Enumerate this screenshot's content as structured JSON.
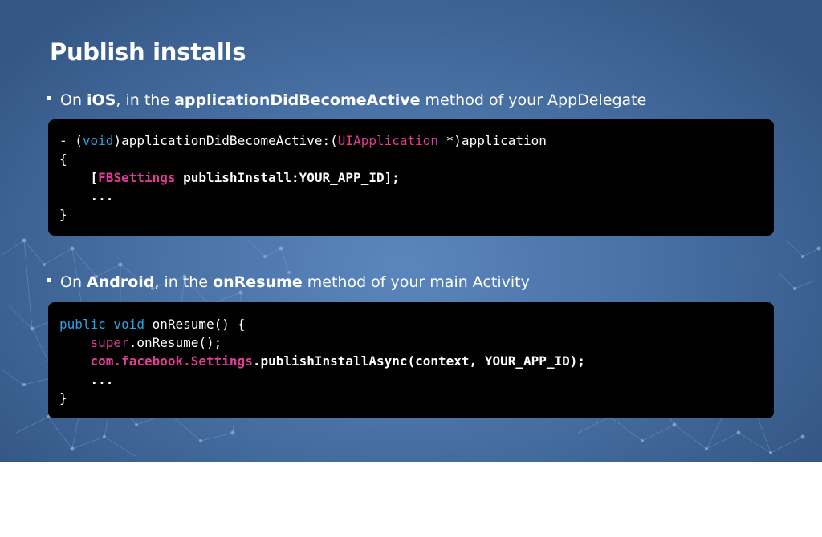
{
  "slide": {
    "title": "Publish installs",
    "ios_bullet": {
      "prefix": "On ",
      "platform": "iOS",
      "middle": ", in the ",
      "method": "applicationDidBecomeActive",
      "suffix": " method of your AppDelegate"
    },
    "ios_code": {
      "line1": {
        "dash": "- (",
        "kw": "void",
        "mid": ")applicationDidBecomeActive:(",
        "type": "UIApplication",
        "rest": " *)application"
      },
      "line2": "{",
      "line3": {
        "indent": "    [",
        "type": "FBSettings",
        "rest": " publishInstall:YOUR_APP_ID];"
      },
      "line4": "    ...",
      "line5": "}"
    },
    "android_bullet": {
      "prefix": "On ",
      "platform": "Android",
      "middle": ", in the ",
      "method": "onResume",
      "suffix": " method of your main Activity"
    },
    "android_code": {
      "line1": {
        "kw": "public void",
        "rest": " onResume() {"
      },
      "line2": {
        "indent": "    ",
        "kw": "super",
        "rest": ".onResume();"
      },
      "line3": {
        "indent": "    ",
        "type": "com.facebook.Settings",
        "rest": ".publishInstallAsync(context, YOUR_APP_ID);"
      },
      "line4": "    ...",
      "line5": "}"
    }
  },
  "colors": {
    "keyword": "#29a3e6",
    "type": "#e43c95",
    "background": "#4a73a7",
    "code_background": "#000000"
  }
}
